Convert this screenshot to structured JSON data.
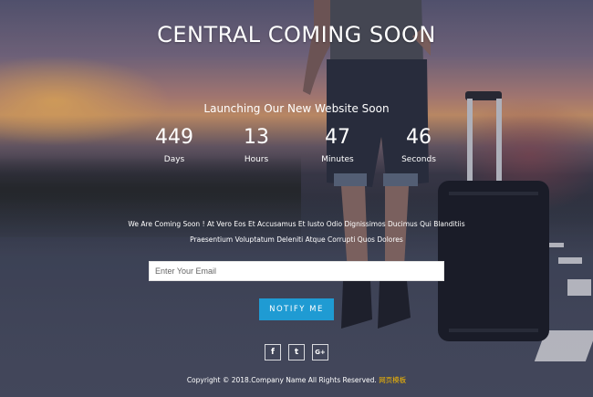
{
  "title": "CENTRAL COMING SOON",
  "subtitle": "Launching Our New Website Soon",
  "countdown": [
    {
      "value": "449",
      "label": "Days"
    },
    {
      "value": "13",
      "label": "Hours"
    },
    {
      "value": "47",
      "label": "Minutes"
    },
    {
      "value": "46",
      "label": "Seconds"
    }
  ],
  "description": {
    "line1": "We Are Coming Soon ! At Vero Eos Et Accusamus Et Iusto Odio Dignissimos Ducimus Qui Blanditiis",
    "line2": "Praesentium Voluptatum Deleniti Atque Corrupti Quos Dolores"
  },
  "form": {
    "email_placeholder": "Enter Your Email",
    "email_value": "",
    "submit_label": "NOTIFY ME"
  },
  "social": [
    {
      "icon": "facebook-icon",
      "glyph": "f"
    },
    {
      "icon": "twitter-icon",
      "glyph": "t"
    },
    {
      "icon": "google-plus-icon",
      "glyph": "G+"
    }
  ],
  "footer": {
    "text": "Copyright © 2018.Company Name All Rights Reserved.",
    "link": "网页模板"
  },
  "colors": {
    "accent": "#1f9bd3",
    "footer_link": "#f5b800"
  }
}
